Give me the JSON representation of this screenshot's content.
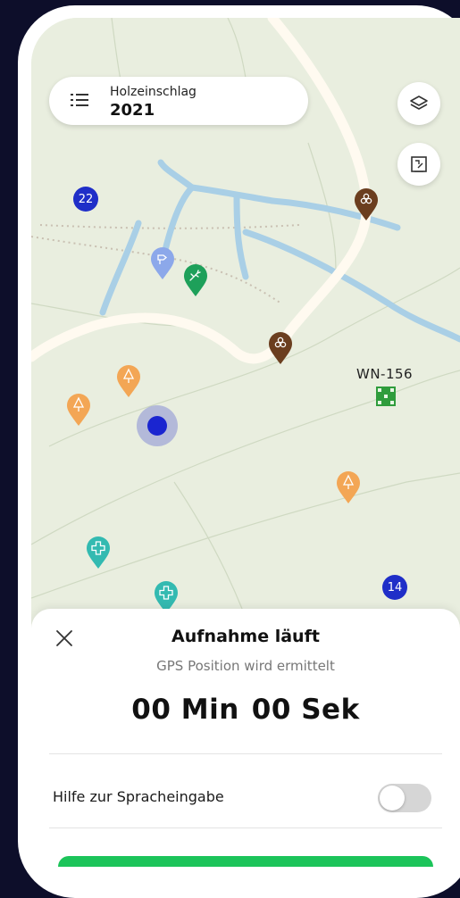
{
  "layer_selector": {
    "label": "Holzeinschlag",
    "year": "2021"
  },
  "map": {
    "cluster_badges": [
      "22",
      "14"
    ],
    "stand_label": "WN-156",
    "colors": {
      "background": "#e9eedf",
      "road": "#fffaf0",
      "water": "#a9cfe6",
      "location": "#1a25d0",
      "badge": "#1f2ec8",
      "pin_brown": "#6b3e1f",
      "pin_orange": "#f3a655",
      "pin_green": "#1ea05a",
      "pin_teal": "#33bab1",
      "pin_lightblue": "#8ca8ea"
    },
    "pins": [
      {
        "kind": "wood-pile",
        "color": "brown"
      },
      {
        "kind": "wood-pile",
        "color": "brown"
      },
      {
        "kind": "sign",
        "color": "lightblue"
      },
      {
        "kind": "deer",
        "color": "green"
      },
      {
        "kind": "tree",
        "color": "orange"
      },
      {
        "kind": "tree",
        "color": "orange"
      },
      {
        "kind": "tree",
        "color": "orange"
      },
      {
        "kind": "first-aid",
        "color": "teal"
      },
      {
        "kind": "first-aid",
        "color": "teal"
      }
    ]
  },
  "recording_sheet": {
    "title": "Aufnahme läuft",
    "subtitle": "GPS Position wird ermittelt",
    "timer_minutes": "00 Min",
    "timer_seconds": "00 Sek",
    "voice_help_label": "Hilfe zur Spracheingabe",
    "voice_help_enabled": false,
    "accent_color": "#1cc45a"
  },
  "icons": [
    "list-icon",
    "layers-icon",
    "map-area-icon",
    "close-icon"
  ]
}
